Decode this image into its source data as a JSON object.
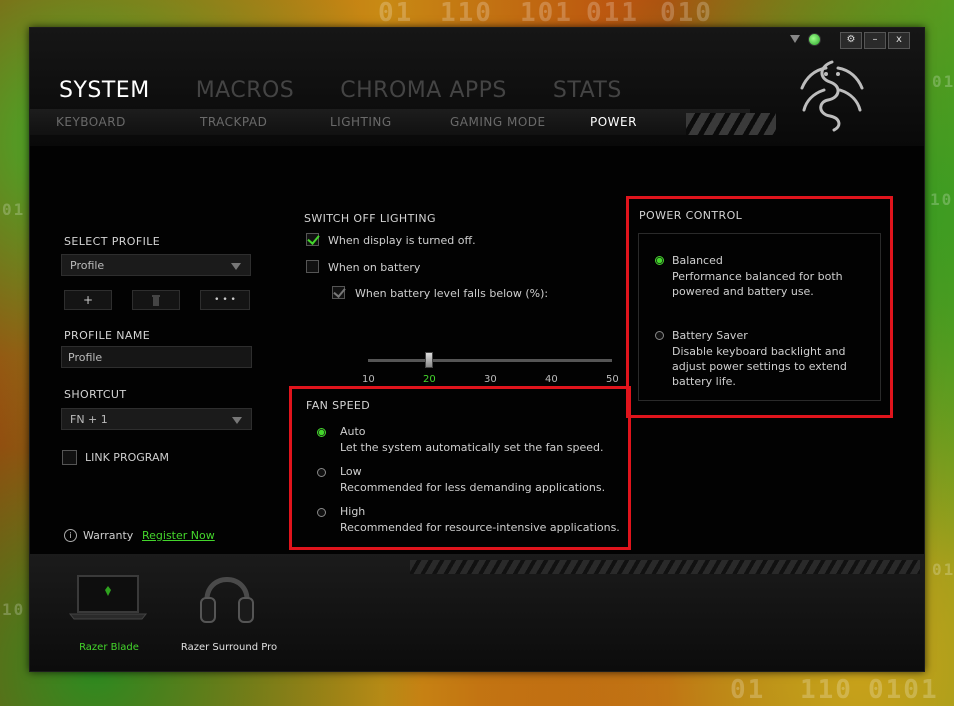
{
  "background": {
    "bits": [
      "01",
      "110",
      "101",
      "011",
      "010",
      "01",
      "110",
      "01",
      "0101",
      "01",
      "10",
      "10",
      "01"
    ]
  },
  "window": {
    "controls": {
      "settings": "⚙",
      "minimize": "–",
      "close": "x"
    }
  },
  "nav": {
    "main_tabs": [
      "SYSTEM",
      "MACROS",
      "CHROMA APPS",
      "STATS"
    ],
    "sub_tabs": [
      "KEYBOARD",
      "TRACKPAD",
      "LIGHTING",
      "GAMING MODE",
      "POWER"
    ]
  },
  "profile": {
    "select_label": "SELECT PROFILE",
    "selected": "Profile",
    "add": "+",
    "more": "• • •",
    "name_label": "PROFILE NAME",
    "name_value": "Profile",
    "shortcut_label": "SHORTCUT",
    "shortcut_value": "FN + 1",
    "link_program": "LINK PROGRAM"
  },
  "lighting": {
    "title": "SWITCH OFF LIGHTING",
    "display_off": "When display is turned off.",
    "display_off_checked": true,
    "on_battery": "When on battery",
    "on_battery_checked": false,
    "battery_level": "When battery level falls below (%):",
    "battery_level_checked": true,
    "slider_value": 20,
    "slider_ticks": [
      "10",
      "20",
      "30",
      "40",
      "50"
    ]
  },
  "fan": {
    "title": "FAN SPEED",
    "options": [
      {
        "label": "Auto",
        "desc": "Let the system automatically set the fan speed.",
        "selected": true
      },
      {
        "label": "Low",
        "desc": "Recommended for less demanding applications.",
        "selected": false
      },
      {
        "label": "High",
        "desc": "Recommended for resource-intensive applications.",
        "selected": false
      }
    ]
  },
  "power": {
    "title": "POWER CONTROL",
    "options": [
      {
        "label": "Balanced",
        "desc1": "Performance balanced for both",
        "desc2": "powered and battery use.",
        "desc3": "",
        "selected": true
      },
      {
        "label": "Battery Saver",
        "desc1": "Disable keyboard backlight and",
        "desc2": "adjust power settings to extend",
        "desc3": "battery life.",
        "selected": false
      }
    ]
  },
  "footer": {
    "info_icon": "i",
    "warranty": "Warranty",
    "register": "Register Now"
  },
  "devices": [
    {
      "name": "Razer Blade",
      "active": true
    },
    {
      "name": "Razer Surround Pro",
      "active": false
    }
  ],
  "colors": {
    "accent": "#44d62c",
    "highlight": "#e0141c"
  }
}
